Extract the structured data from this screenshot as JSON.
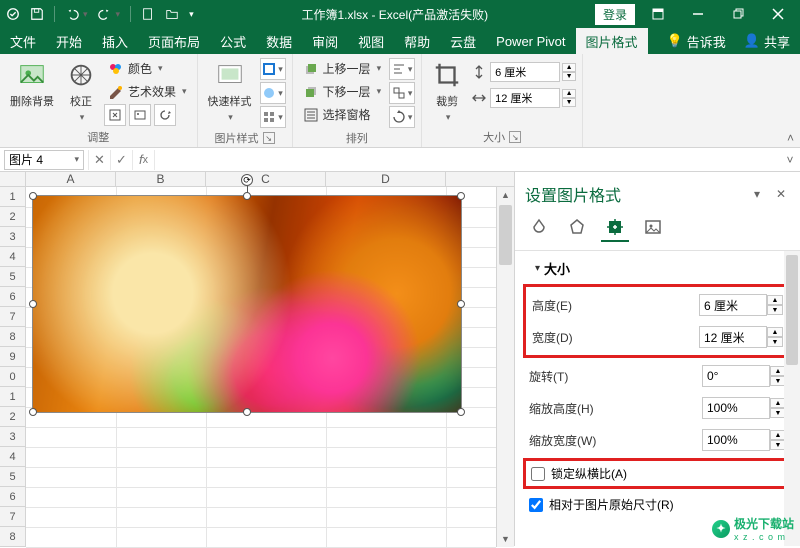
{
  "titlebar": {
    "title": "工作簿1.xlsx  -  Excel(产品激活失败)",
    "login": "登录"
  },
  "tabs": {
    "file": "文件",
    "home": "开始",
    "insert": "插入",
    "page_layout": "页面布局",
    "formulas": "公式",
    "data": "数据",
    "review": "审阅",
    "view": "视图",
    "help": "帮助",
    "cloud": "云盘",
    "power_pivot": "Power Pivot",
    "picture_format": "图片格式",
    "tell_me": "告诉我",
    "share": "共享"
  },
  "ribbon": {
    "remove_bg": "删除背景",
    "corrections": "校正",
    "color": "颜色",
    "artistic": "艺术效果",
    "adjust_group": "调整",
    "quick_styles": "快速样式",
    "styles_group": "图片样式",
    "bring_forward": "上移一层",
    "send_backward": "下移一层",
    "selection_pane": "选择窗格",
    "arrange_group": "排列",
    "crop": "裁剪",
    "height_value": "6 厘米",
    "width_value": "12 厘米",
    "size_group": "大小"
  },
  "namebox": {
    "value": "图片 4"
  },
  "columns": {
    "a": "A",
    "b": "B",
    "c": "C",
    "d": "D"
  },
  "rows": [
    "1",
    "2",
    "3",
    "4",
    "5",
    "6",
    "7",
    "8",
    "9",
    "0",
    "1",
    "2",
    "3",
    "4",
    "5",
    "6",
    "7",
    "8"
  ],
  "format_pane": {
    "title": "设置图片格式",
    "section_size": "大小",
    "height_label": "高度(E)",
    "height_value": "6 厘米",
    "width_label": "宽度(D)",
    "width_value": "12 厘米",
    "rotation_label": "旋转(T)",
    "rotation_value": "0°",
    "scale_h_label": "缩放高度(H)",
    "scale_h_value": "100%",
    "scale_w_label": "缩放宽度(W)",
    "scale_w_value": "100%",
    "lock_aspect": "锁定纵横比(A)",
    "relative_original": "相对于图片原始尺寸(R)"
  },
  "watermark": {
    "text": "极光下载站",
    "url": "x z . c o m"
  }
}
